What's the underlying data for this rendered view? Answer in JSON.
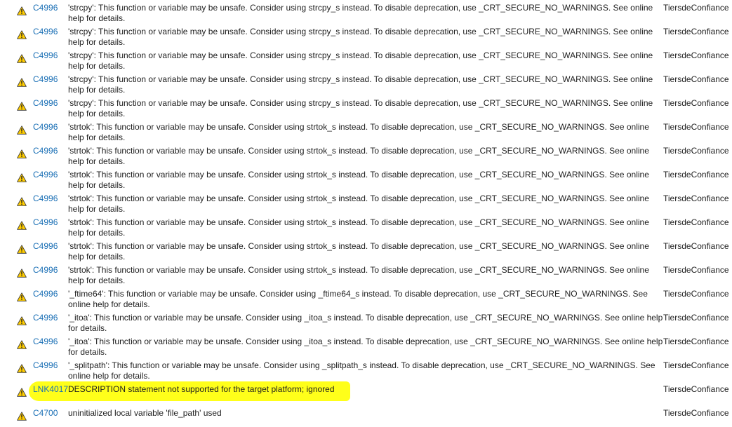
{
  "error_list": {
    "rows": [
      {
        "code": "C4996",
        "description": "'strcpy': This function or variable may be unsafe. Consider using strcpy_s instead. To disable deprecation, use _CRT_SECURE_NO_WARNINGS. See online help for details.",
        "project": "TiersdeConfiance",
        "severity_icon": "warning-icon"
      },
      {
        "code": "C4996",
        "description": "'strcpy': This function or variable may be unsafe. Consider using strcpy_s instead. To disable deprecation, use _CRT_SECURE_NO_WARNINGS. See online help for details.",
        "project": "TiersdeConfiance",
        "severity_icon": "warning-icon"
      },
      {
        "code": "C4996",
        "description": "'strcpy': This function or variable may be unsafe. Consider using strcpy_s instead. To disable deprecation, use _CRT_SECURE_NO_WARNINGS. See online help for details.",
        "project": "TiersdeConfiance",
        "severity_icon": "warning-icon"
      },
      {
        "code": "C4996",
        "description": "'strcpy': This function or variable may be unsafe. Consider using strcpy_s instead. To disable deprecation, use _CRT_SECURE_NO_WARNINGS. See online help for details.",
        "project": "TiersdeConfiance",
        "severity_icon": "warning-icon"
      },
      {
        "code": "C4996",
        "description": "'strcpy': This function or variable may be unsafe. Consider using strcpy_s instead. To disable deprecation, use _CRT_SECURE_NO_WARNINGS. See online help for details.",
        "project": "TiersdeConfiance",
        "severity_icon": "warning-icon"
      },
      {
        "code": "C4996",
        "description": "'strtok': This function or variable may be unsafe. Consider using strtok_s instead. To disable deprecation, use _CRT_SECURE_NO_WARNINGS. See online help for details.",
        "project": "TiersdeConfiance",
        "severity_icon": "warning-icon"
      },
      {
        "code": "C4996",
        "description": "'strtok': This function or variable may be unsafe. Consider using strtok_s instead. To disable deprecation, use _CRT_SECURE_NO_WARNINGS. See online help for details.",
        "project": "TiersdeConfiance",
        "severity_icon": "warning-icon"
      },
      {
        "code": "C4996",
        "description": "'strtok': This function or variable may be unsafe. Consider using strtok_s instead. To disable deprecation, use _CRT_SECURE_NO_WARNINGS. See online help for details.",
        "project": "TiersdeConfiance",
        "severity_icon": "warning-icon"
      },
      {
        "code": "C4996",
        "description": "'strtok': This function or variable may be unsafe. Consider using strtok_s instead. To disable deprecation, use _CRT_SECURE_NO_WARNINGS. See online help for details.",
        "project": "TiersdeConfiance",
        "severity_icon": "warning-icon"
      },
      {
        "code": "C4996",
        "description": "'strtok': This function or variable may be unsafe. Consider using strtok_s instead. To disable deprecation, use _CRT_SECURE_NO_WARNINGS. See online help for details.",
        "project": "TiersdeConfiance",
        "severity_icon": "warning-icon"
      },
      {
        "code": "C4996",
        "description": "'strtok': This function or variable may be unsafe. Consider using strtok_s instead. To disable deprecation, use _CRT_SECURE_NO_WARNINGS. See online help for details.",
        "project": "TiersdeConfiance",
        "severity_icon": "warning-icon"
      },
      {
        "code": "C4996",
        "description": "'strtok': This function or variable may be unsafe. Consider using strtok_s instead. To disable deprecation, use _CRT_SECURE_NO_WARNINGS. See online help for details.",
        "project": "TiersdeConfiance",
        "severity_icon": "warning-icon"
      },
      {
        "code": "C4996",
        "description": "'_ftime64': This function or variable may be unsafe. Consider using _ftime64_s instead. To disable deprecation, use _CRT_SECURE_NO_WARNINGS. See online help for details.",
        "project": "TiersdeConfiance",
        "severity_icon": "warning-icon"
      },
      {
        "code": "C4996",
        "description": "'_itoa': This function or variable may be unsafe. Consider using _itoa_s instead. To disable deprecation, use _CRT_SECURE_NO_WARNINGS. See online help for details.",
        "project": "TiersdeConfiance",
        "severity_icon": "warning-icon"
      },
      {
        "code": "C4996",
        "description": "'_itoa': This function or variable may be unsafe. Consider using _itoa_s instead. To disable deprecation, use _CRT_SECURE_NO_WARNINGS. See online help for details.",
        "project": "TiersdeConfiance",
        "severity_icon": "warning-icon"
      },
      {
        "code": "C4996",
        "description": "'_splitpath': This function or variable may be unsafe. Consider using _splitpath_s instead. To disable deprecation, use _CRT_SECURE_NO_WARNINGS. See online help for details.",
        "project": "TiersdeConfiance",
        "severity_icon": "warning-icon"
      },
      {
        "code": "LNK4017",
        "description": "DESCRIPTION statement not supported for the target platform; ignored",
        "project": "TiersdeConfiance",
        "severity_icon": "warning-icon",
        "highlighted": true
      },
      {
        "code": "C4700",
        "description": "uninitialized local variable 'file_path' used",
        "project": "TiersdeConfiance",
        "severity_icon": "warning-icon"
      }
    ]
  },
  "colors": {
    "code_link": "#1a6fb5",
    "highlight": "#ffff1a",
    "warning_fill": "#ffcc00",
    "text": "#1e1e1e"
  }
}
